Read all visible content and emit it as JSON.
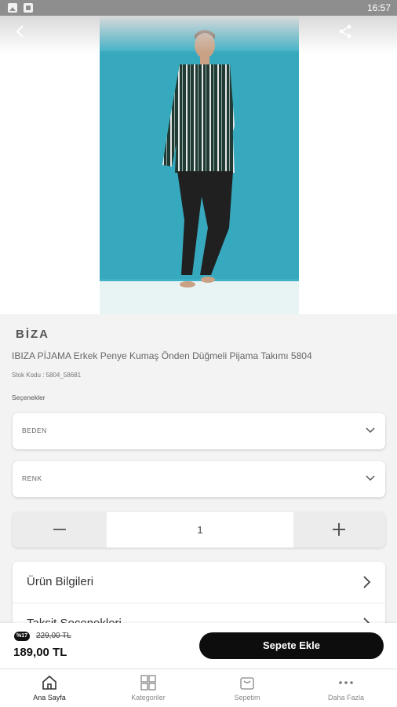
{
  "status_bar": {
    "time": "16:57",
    "icons": [
      "image-icon",
      "document-icon"
    ]
  },
  "product": {
    "brand": "BİZA",
    "title": "IBIZA PİJAMA Erkek Penye Kumaş Önden Düğmeli Pijama Takımı 5804",
    "sku": "Stok Kodu : 5804_58681",
    "options_label": "Seçenekler",
    "size_select": {
      "label": "BEDEN"
    },
    "color_select": {
      "label": "RENK"
    },
    "quantity": "1"
  },
  "info_rows": [
    {
      "label": "Ürün Bilgileri"
    },
    {
      "label": "Taksit Seçenekleri"
    }
  ],
  "buy_bar": {
    "discount_badge": "%17",
    "old_price": "229,00 TL",
    "price": "189,00 TL",
    "add_to_cart_label": "Sepete Ekle"
  },
  "tab_bar": {
    "items": [
      {
        "label": "Ana Sayfa",
        "icon": "home-icon",
        "active": true
      },
      {
        "label": "Kategoriler",
        "icon": "grid-icon",
        "active": false
      },
      {
        "label": "Sepetim",
        "icon": "cart-icon",
        "active": false
      },
      {
        "label": "Daha Fazla",
        "icon": "more-icon",
        "active": false
      }
    ]
  },
  "colors": {
    "accent": "#000000",
    "photo_background": "#3eb1c6"
  }
}
